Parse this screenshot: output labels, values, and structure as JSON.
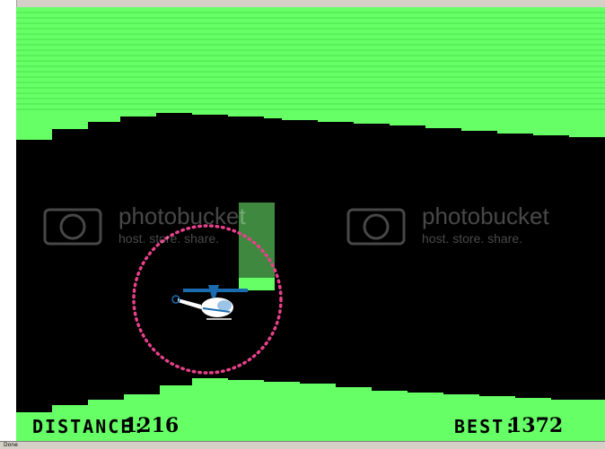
{
  "game": {
    "hud": {
      "distance_label": "DISTANCE:",
      "distance_value": "1216",
      "best_label": "BEST:",
      "best_value": "1372"
    },
    "watermark": {
      "brand": "photobucket",
      "tagline": "host. store. share."
    },
    "colors": {
      "cave_wall": "#66ff66",
      "background": "#000000",
      "obstacle": "#4aaa4a",
      "target_ring": "#e8408a",
      "helicopter_body": "#ffffff",
      "helicopter_accent": "#1a6bb0"
    }
  },
  "status_bar": {
    "text": "Done"
  }
}
